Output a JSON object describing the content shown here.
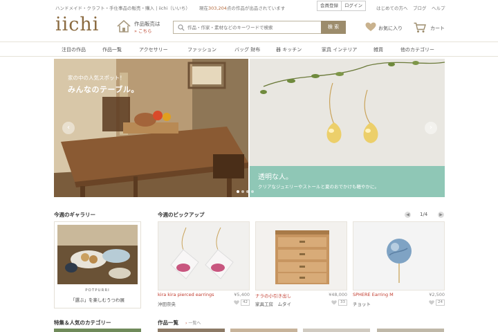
{
  "topbar": {
    "tagline": "ハンドメイド・クラフト・手仕事品の販売・購入 | iichi（いいち）",
    "count_prefix": "現在",
    "count_value": "303,204",
    "count_suffix": "点の作品が出品されています",
    "register": "会員登録",
    "login": "ログイン",
    "links": [
      "はじめての方へ",
      "ブログ",
      "ヘルプ"
    ]
  },
  "header": {
    "logo": "iichi",
    "sell_line1": "作品販売は",
    "sell_line2": "» こちら",
    "search_placeholder": "作品・作家・素材などのキーワードで検索",
    "search_button": "検 索",
    "favorites": "お気に入り",
    "cart": "カート"
  },
  "nav": [
    "注目の作品",
    "作品一覧",
    "アクセサリー",
    "ファッション",
    "バッグ 財布",
    "器 キッチン",
    "家具 インテリア",
    "雑貨",
    "他のカテゴリー"
  ],
  "hero": {
    "slide1_kicker": "家の中の人気スポット！",
    "slide1_title": "みんなのテーブル。",
    "slide2_title": "透明な人。",
    "slide2_sub": "クリアなジュエリーやストールと夏のおでかけも軽やかに。",
    "prev": "‹",
    "next": "›"
  },
  "gallery": {
    "title": "今週のギャラリー",
    "brand": "POTPURRI",
    "caption": "「選ぶ」を楽しむうつわ展"
  },
  "pickup": {
    "title": "今週のピックアップ",
    "page": "1/4",
    "items": [
      {
        "name": "kira kira pierced earrings",
        "price": "¥5,400",
        "maker": "沖田奈央",
        "likes": "42"
      },
      {
        "name": "ナラの小引き出し",
        "price": "¥48,000",
        "maker": "家具工房　ムタイ",
        "likes": "33"
      },
      {
        "name": "SPHERE Earring M",
        "price": "¥2,500",
        "maker": "チョット",
        "likes": "24"
      }
    ]
  },
  "featured": {
    "title": "特集＆人気のカテゴリー"
  },
  "listing": {
    "title": "作品一覧",
    "see_all": "一覧へ"
  },
  "colors": {
    "accent": "#c0392b",
    "brand": "#8a6a3f",
    "search_button": "#9c8c6c",
    "mint": "#8fc7b6"
  }
}
